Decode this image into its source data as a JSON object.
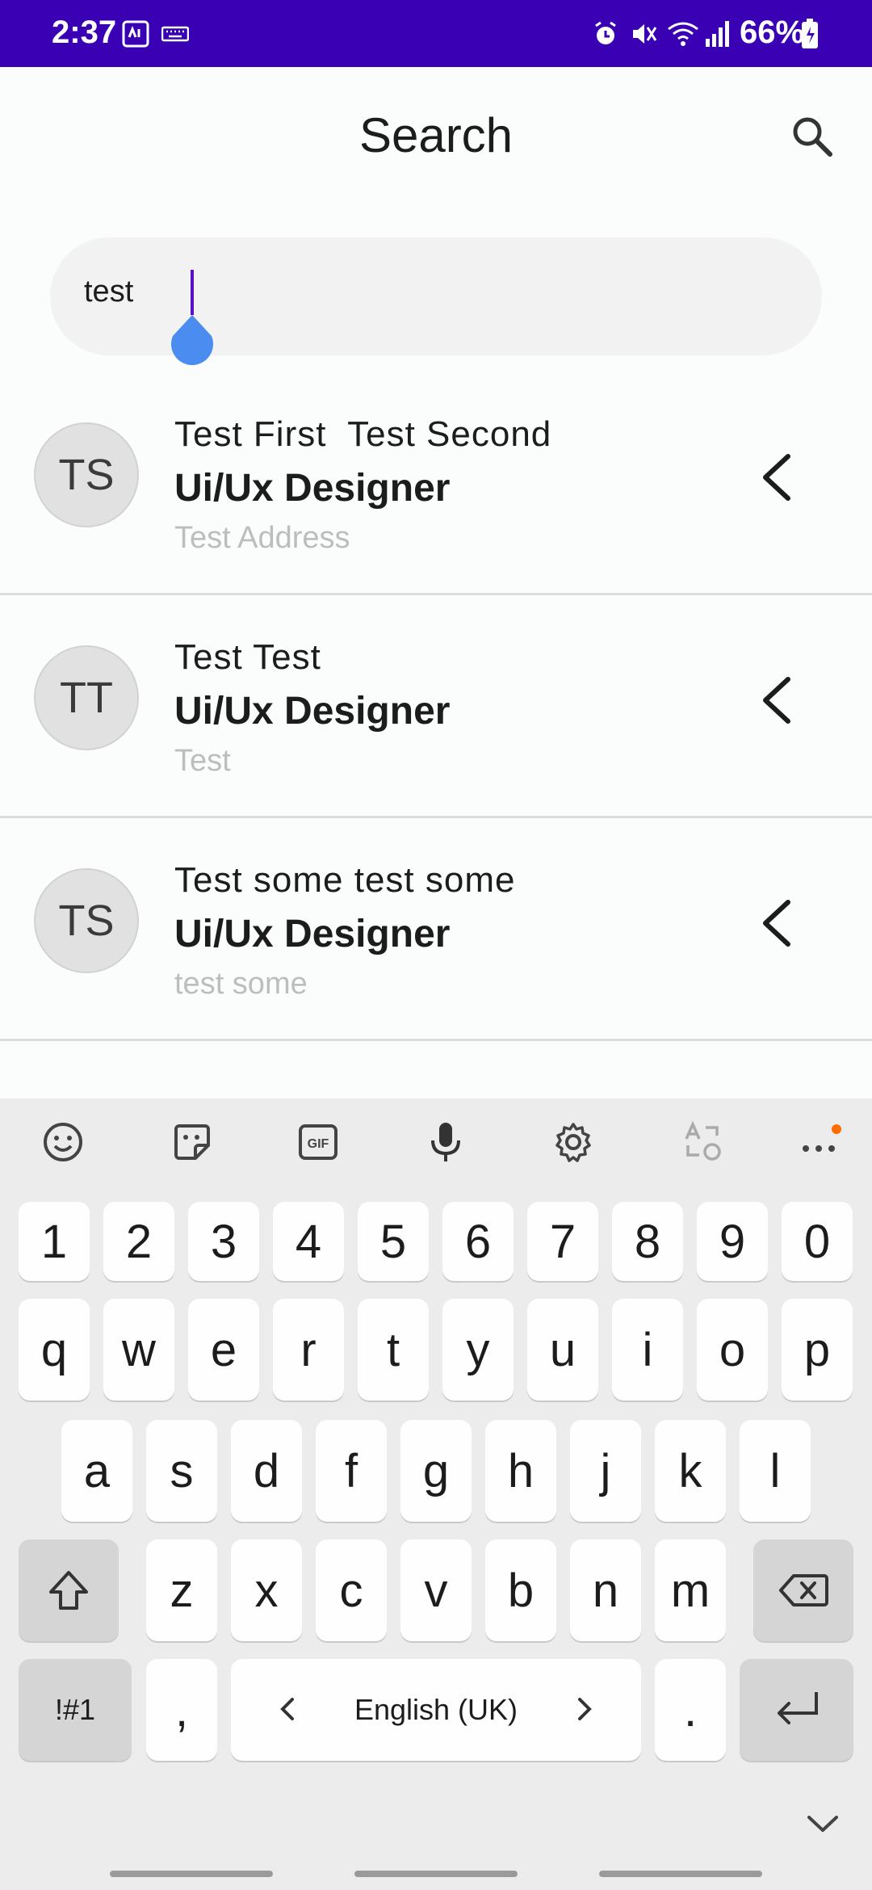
{
  "status_bar": {
    "time": "2:37",
    "battery": "66%",
    "background": "#3a00b4",
    "icons": [
      "sim-icon",
      "keyboard-icon",
      "alarm-icon",
      "mute-icon",
      "wifi-icon",
      "signal-icon",
      "battery-icon"
    ]
  },
  "app_bar": {
    "title": "Search",
    "search_icon": "search-icon"
  },
  "search": {
    "value": "test"
  },
  "results": [
    {
      "initials": "TS",
      "name": "Test First  Test Second",
      "role": "Ui/Ux Designer",
      "address": "Test Address"
    },
    {
      "initials": "TT",
      "name": "Test Test",
      "role": "Ui/Ux Designer",
      "address": "Test"
    },
    {
      "initials": "TS",
      "name": "Test some test some",
      "role": "Ui/Ux Designer",
      "address": "test some"
    }
  ],
  "keyboard": {
    "toolbar": [
      "emoji-icon",
      "sticker-icon",
      "gif-icon",
      "mic-icon",
      "settings-icon",
      "translate-icon",
      "more-icon"
    ],
    "gif_label": "GIF",
    "row_numbers": [
      "1",
      "2",
      "3",
      "4",
      "5",
      "6",
      "7",
      "8",
      "9",
      "0"
    ],
    "row_top": [
      "q",
      "w",
      "e",
      "r",
      "t",
      "y",
      "u",
      "i",
      "o",
      "p"
    ],
    "row_mid": [
      "a",
      "s",
      "d",
      "f",
      "g",
      "h",
      "j",
      "k",
      "l"
    ],
    "row_bottom": [
      "z",
      "x",
      "c",
      "v",
      "b",
      "n",
      "m"
    ],
    "symbols_label": "!#1",
    "comma_label": ",",
    "space_label": "English (UK)",
    "period_label": ".",
    "accent_color": "#ff6d00"
  }
}
